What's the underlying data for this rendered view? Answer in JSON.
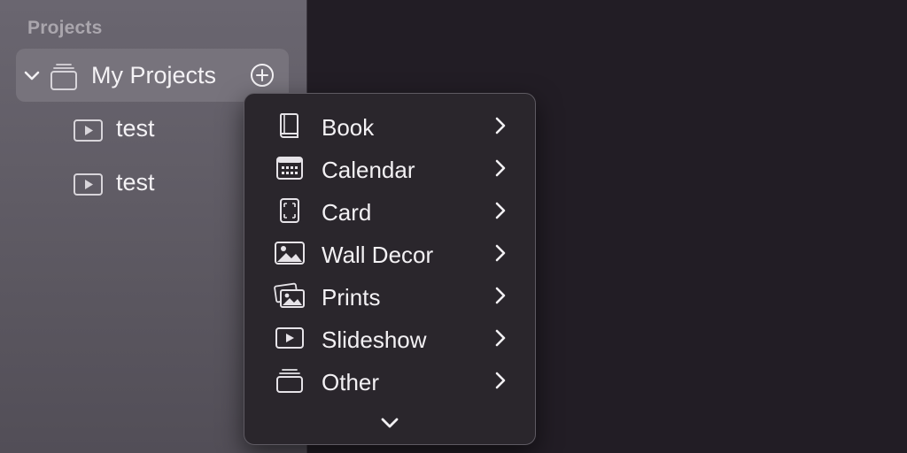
{
  "sidebar": {
    "section_title": "Projects",
    "folder": {
      "label": "My Projects",
      "expanded": true,
      "icon": "stack-icon",
      "add_icon": "plus-circle-icon"
    },
    "projects": [
      {
        "label": "test",
        "icon": "slideshow-icon"
      },
      {
        "label": "test",
        "icon": "slideshow-icon"
      }
    ]
  },
  "menu": {
    "items": [
      {
        "label": "Book",
        "icon": "book-icon"
      },
      {
        "label": "Calendar",
        "icon": "calendar-icon"
      },
      {
        "label": "Card",
        "icon": "card-icon"
      },
      {
        "label": "Wall Decor",
        "icon": "photo-icon"
      },
      {
        "label": "Prints",
        "icon": "prints-icon"
      },
      {
        "label": "Slideshow",
        "icon": "slideshow-icon"
      },
      {
        "label": "Other",
        "icon": "stack-icon"
      }
    ],
    "scroll_icon": "chevron-down-icon"
  },
  "colors": {
    "menu_background": "#2a262c",
    "sidebar_background": "#6a6670",
    "selected_row": "#77737c",
    "canvas_background": "#221d25"
  }
}
